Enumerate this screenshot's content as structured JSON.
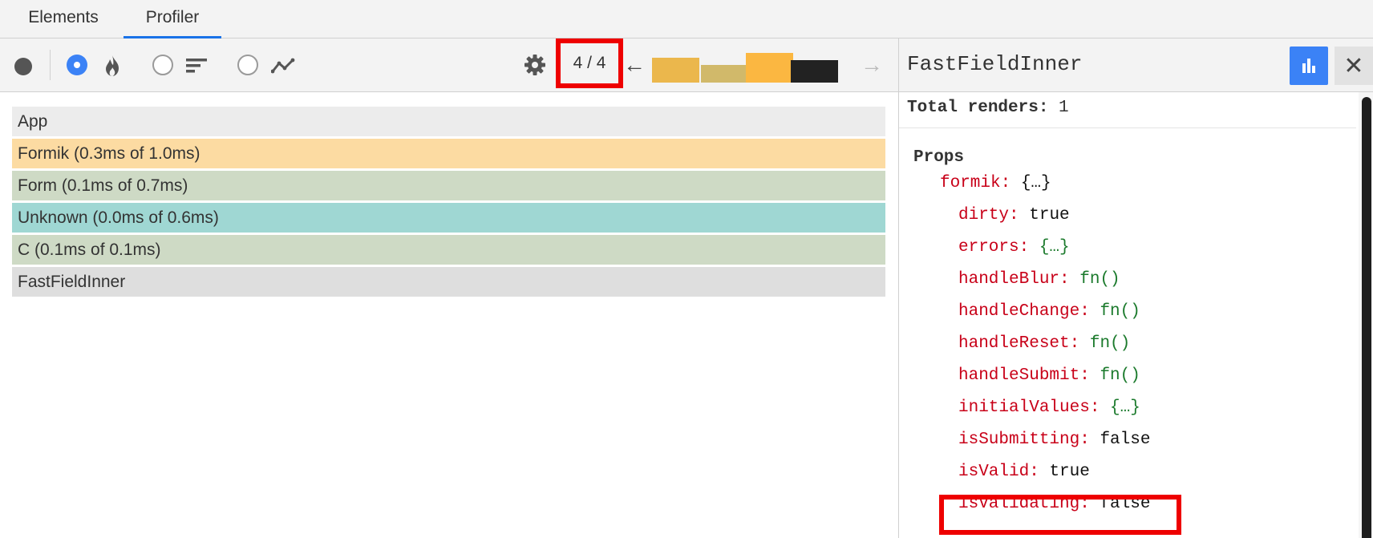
{
  "tabs": [
    {
      "label": "Elements",
      "active": false
    },
    {
      "label": "Profiler",
      "active": true
    }
  ],
  "toolbar": {
    "commit_nav": "4 / 4",
    "prev_arrow": "←",
    "next_arrow": "→",
    "commit_bars": [
      {
        "height": 0.6,
        "color": "#ebb74c"
      },
      {
        "height": 0.43,
        "color": "#d1b96a"
      },
      {
        "height": 0.71,
        "color": "#fbb741"
      },
      {
        "height": 0.54,
        "color": "#222222"
      }
    ],
    "icons": [
      "record-icon",
      "flame-icon",
      "ranked-icon",
      "timeline-icon",
      "gear-icon"
    ]
  },
  "flame_rows": [
    {
      "label": "App",
      "color": "#ececec"
    },
    {
      "label": "Formik (0.3ms of 1.0ms)",
      "color": "#fcdba2"
    },
    {
      "label": "Form (0.1ms of 0.7ms)",
      "color": "#cedac5"
    },
    {
      "label": "Unknown (0.0ms of 0.6ms)",
      "color": "#9fd7d3"
    },
    {
      "label": "C (0.1ms of 0.1ms)",
      "color": "#cedac5"
    },
    {
      "label": "FastFieldInner",
      "color": "#dedede"
    }
  ],
  "right_panel": {
    "title": "FastFieldInner",
    "close_label": "✕",
    "renders_label": "Total renders:",
    "renders_value": "1",
    "props_title": "Props",
    "props": [
      {
        "key": "formik:",
        "value": "{…}",
        "green": false,
        "indent": 0
      },
      {
        "key": "dirty:",
        "value": "true",
        "green": false,
        "indent": 1
      },
      {
        "key": "errors:",
        "value": "{…}",
        "green": true,
        "indent": 1
      },
      {
        "key": "handleBlur:",
        "value": "fn()",
        "green": true,
        "indent": 1
      },
      {
        "key": "handleChange:",
        "value": "fn()",
        "green": true,
        "indent": 1
      },
      {
        "key": "handleReset:",
        "value": "fn()",
        "green": true,
        "indent": 1
      },
      {
        "key": "handleSubmit:",
        "value": "fn()",
        "green": true,
        "indent": 1
      },
      {
        "key": "initialValues:",
        "value": "{…}",
        "green": true,
        "indent": 1
      },
      {
        "key": "isSubmitting:",
        "value": "false",
        "green": false,
        "indent": 1
      },
      {
        "key": "isValid:",
        "value": "true",
        "green": false,
        "indent": 1
      },
      {
        "key": "isValidating:",
        "value": "false",
        "green": false,
        "indent": 1
      }
    ]
  }
}
